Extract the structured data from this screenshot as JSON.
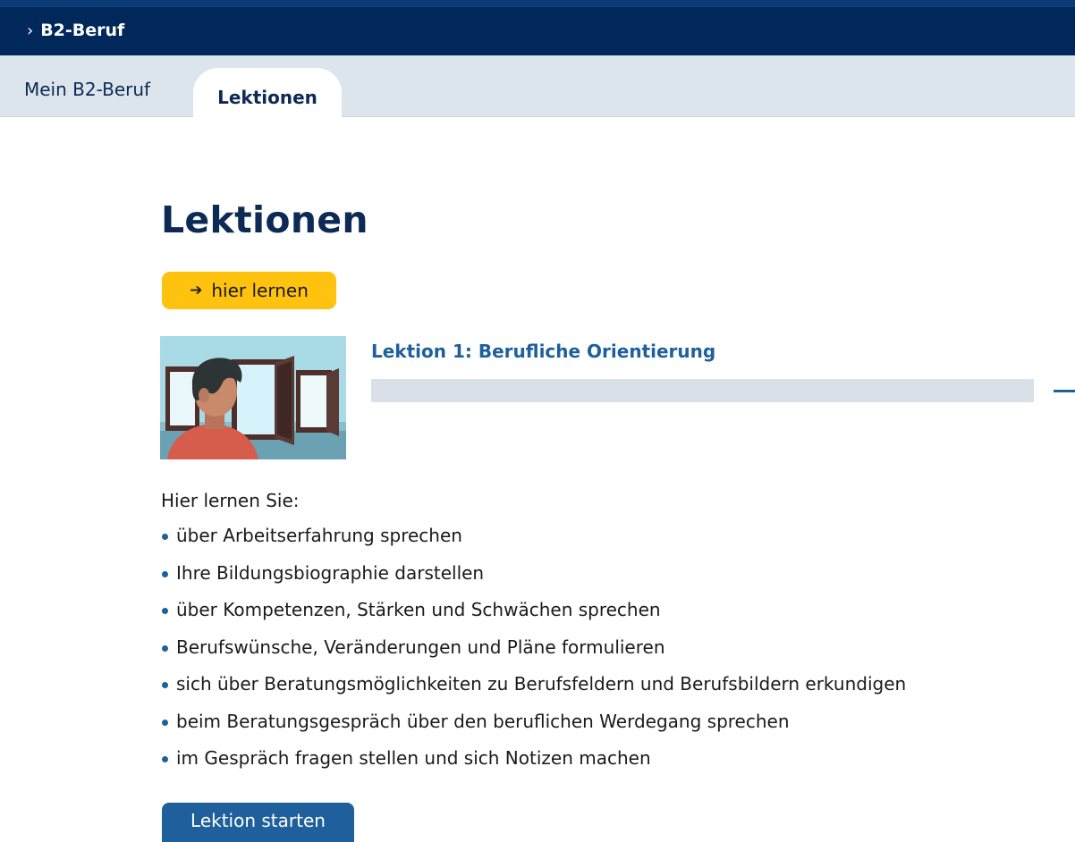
{
  "header": {
    "breadcrumb_chevron": "›",
    "breadcrumb_label": "B2-Beruf"
  },
  "tabs": [
    {
      "label": "Mein B2-Beruf",
      "active": false
    },
    {
      "label": "Lektionen",
      "active": true
    }
  ],
  "main": {
    "title": "Lektionen",
    "learn_button": {
      "arrow": "➔",
      "label": "hier lernen"
    },
    "lesson": {
      "title": "Lektion 1: Berufliche Orientierung",
      "progress": 0,
      "intro": "Hier lernen Sie:",
      "goals": [
        "über Arbeitserfahrung sprechen",
        "Ihre Bildungsbiographie darstellen",
        "über Kompetenzen, Stärken und Schwächen sprechen",
        "Berufswünsche, Veränderungen und Pläne formulieren",
        "sich über Beratungsmöglichkeiten zu Berufsfeldern und Berufsbildern erkundigen",
        "beim Beratungsgespräch über den beruflichen Werdegang sprechen",
        "im Gespräch fragen stellen und sich Notizen machen"
      ],
      "start_label": "Lektion starten"
    }
  },
  "colors": {
    "topbar": "#00285a",
    "tabbar": "#dde5ec",
    "heading": "#0c2a55",
    "accent_blue": "#1f5f9c",
    "accent_yellow": "#ffc20e"
  },
  "icons": {
    "breadcrumb": "chevron-right-icon",
    "learn": "arrow-right-icon",
    "collapse": "minus-icon",
    "bullet": "bullet-dot-icon"
  }
}
